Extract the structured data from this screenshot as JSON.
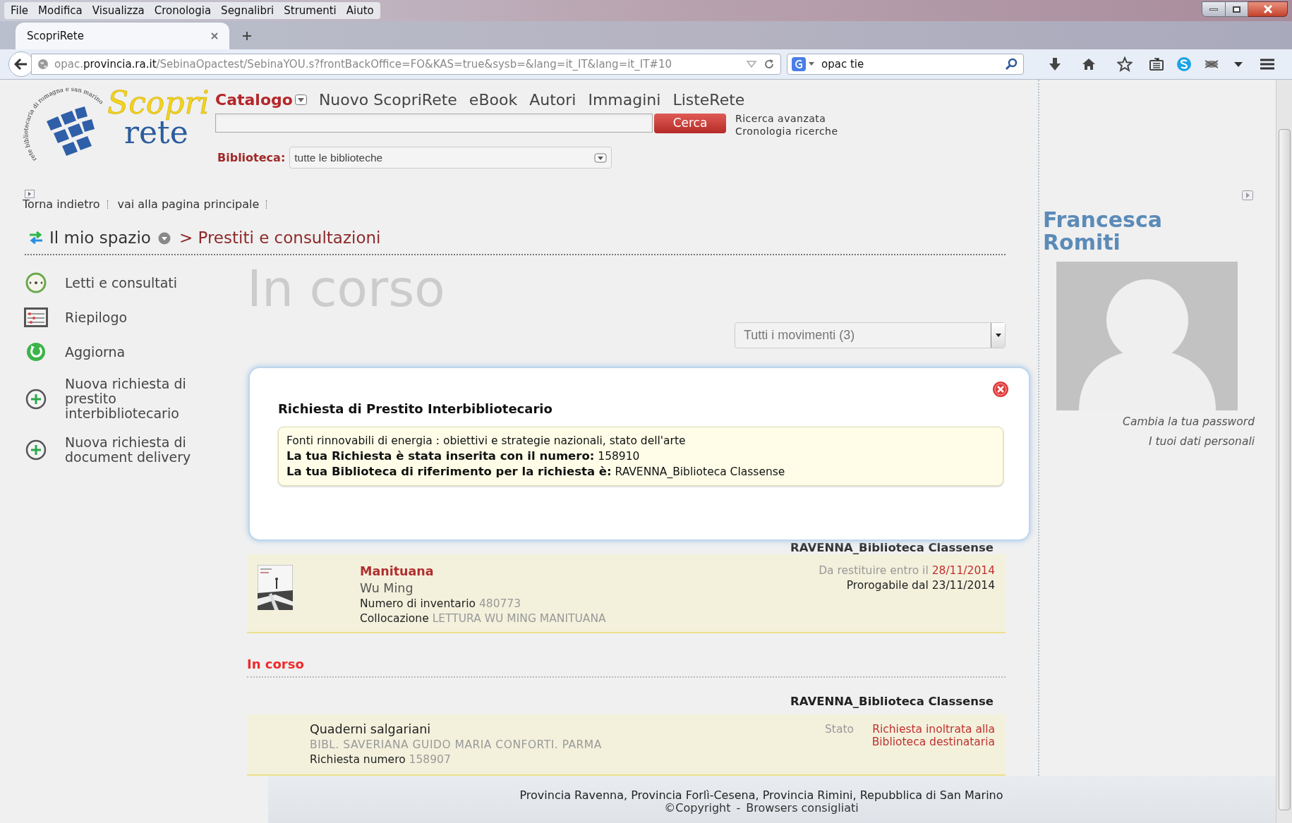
{
  "menu_bar": [
    "File",
    "Modifica",
    "Visualizza",
    "Cronologia",
    "Segnalibri",
    "Strumenti",
    "Aiuto"
  ],
  "tab": {
    "title": "ScopriRete"
  },
  "address_bar": {
    "url": "opac.**provincia.ra.it**/SebinaOpactest/SebinaYOU.s?frontBackOffice=FO&KAS=true&sysb=&lang=it_IT&lang=it_IT#10"
  },
  "search_bar": {
    "value": "opac tie"
  },
  "logo": {
    "word_1": "Scopri",
    "word_2": "rete",
    "motto": "rete bibliotecaria di romagna e san marino"
  },
  "nav": [
    {
      "label": "Catalogo",
      "selected": true
    },
    {
      "label": "Nuovo ScopriRete",
      "selected": false
    },
    {
      "label": "eBook",
      "selected": false
    },
    {
      "label": "Autori",
      "selected": false
    },
    {
      "label": "Immagini",
      "selected": false
    },
    {
      "label": "ListeRete",
      "selected": false
    }
  ],
  "search": {
    "button": "Cerca",
    "links": [
      "Ricerca avanzata",
      "Cronologia ricerche"
    ]
  },
  "library_filter": {
    "label": "Biblioteca:",
    "value": "tutte le biblioteche"
  },
  "quick_links": [
    "Torna indietro",
    "vai alla pagina principale"
  ],
  "breadcrumb": {
    "section": "Il mio spazio",
    "page": "> Prestiti e consultazioni"
  },
  "sidebar": [
    {
      "kind": "clock",
      "label": "Letti e consultati"
    },
    {
      "kind": "summary",
      "label": "Riepilogo"
    },
    {
      "kind": "refresh",
      "label": "Aggiorna"
    },
    {
      "kind": "add",
      "label": "Nuova richiesta di prestito interbibliotecario"
    },
    {
      "kind": "add",
      "label": "Nuova richiesta di document delivery"
    }
  ],
  "page_title": "In corso",
  "movement_filter": {
    "value": "Tutti i movimenti (3)"
  },
  "dialog": {
    "title": "Richiesta di Prestito Interbibliotecario",
    "lines": [
      "Fonti rinnovabili di energia : obiettivi e strategie nazionali, stato dell'arte",
      "**La tua Richiesta è stata inserita con il numero:** 158910",
      "**La tua Biblioteca di riferimento per la richiesta è:** RAVENNA_Biblioteca Classense"
    ]
  },
  "loans": {
    "library": "RAVENNA_Biblioteca Classense",
    "items": [
      {
        "title": "Manituana",
        "author": "Wu Ming",
        "inventory_label": "Numero di inventario",
        "inventory": "480773",
        "location_label": "Collocazione",
        "location": "LETTURA WU MING MANITUANA",
        "due_label": "Da restituire entro il",
        "due_date": "28/11/2014",
        "renewal": "Prorogabile dal 23/11/2014"
      }
    ]
  },
  "requests": {
    "heading": "In corso",
    "library": "RAVENNA_Biblioteca Classense",
    "items": [
      {
        "title": "Quaderni salgariani",
        "lending_library": "BIBL. SAVERIANA GUIDO MARIA CONFORTI. PARMA",
        "number_label": "Richiesta numero",
        "number": "158907",
        "status_label": "Stato",
        "status": "Richiesta inoltrata alla Biblioteca destinataria"
      }
    ]
  },
  "profile": {
    "name": "Francesca Romiti",
    "links": [
      "Cambia la tua password",
      "I tuoi dati personali"
    ]
  },
  "footer": {
    "line": "Provincia Ravenna, Provincia Forlì-Cesena, Provincia Rimini, Repubblica di San Marino",
    "links": [
      "©Copyright",
      "Browsers consigliati"
    ],
    "separator": "-"
  }
}
